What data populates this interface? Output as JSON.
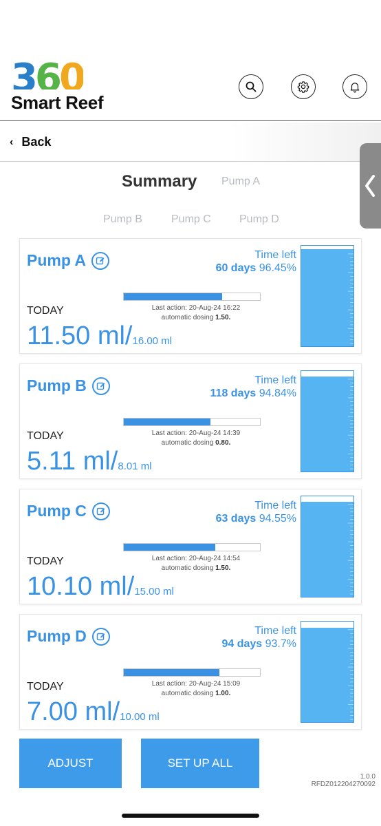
{
  "app": {
    "logo_number": [
      "3",
      "6",
      "0"
    ],
    "logo_text": "Smart Reef"
  },
  "header_icons": [
    "search-icon",
    "gear-icon",
    "bell-icon"
  ],
  "nav": {
    "back_label": "Back"
  },
  "tabs": [
    {
      "label": "Summary",
      "active": true
    },
    {
      "label": "Pump A",
      "active": false
    },
    {
      "label": "Pump B",
      "active": false
    },
    {
      "label": "Pump C",
      "active": false
    },
    {
      "label": "Pump D",
      "active": false
    }
  ],
  "pumps": [
    {
      "name": "Pump A",
      "time_left_label": "Time left",
      "days": "60 days",
      "percent": "96.45%",
      "tank_level": 0.9645,
      "progress": 0.72,
      "last_action": "Last action: 20-Aug-24 16:22",
      "dosing_label": "automatic dosing",
      "dosing_value": "1.50.",
      "today_label": "TODAY",
      "dosed": "11.50 ml/",
      "target": "16.00 ml"
    },
    {
      "name": "Pump B",
      "time_left_label": "Time left",
      "days": "118 days",
      "percent": "94.84%",
      "tank_level": 0.9484,
      "progress": 0.638,
      "last_action": "Last action: 20-Aug-24 14:39",
      "dosing_label": "automatic dosing",
      "dosing_value": "0.80.",
      "today_label": "TODAY",
      "dosed": "5.11 ml/",
      "target": "8.01 ml"
    },
    {
      "name": "Pump C",
      "time_left_label": "Time left",
      "days": "63 days",
      "percent": "94.55%",
      "tank_level": 0.9455,
      "progress": 0.673,
      "last_action": "Last action: 20-Aug-24 14:54",
      "dosing_label": "automatic dosing",
      "dosing_value": "1.50.",
      "today_label": "TODAY",
      "dosed": "10.10 ml/",
      "target": "15.00 ml"
    },
    {
      "name": "Pump D",
      "time_left_label": "Time left",
      "days": "94 days",
      "percent": "93.7%",
      "tank_level": 0.937,
      "progress": 0.7,
      "last_action": "Last action: 20-Aug-24 15:09",
      "dosing_label": "automatic dosing",
      "dosing_value": "1.00.",
      "today_label": "TODAY",
      "dosed": "7.00 ml/",
      "target": "10.00 ml"
    }
  ],
  "buttons": {
    "adjust": "ADJUST",
    "setup_all": "SET UP ALL"
  },
  "footer": {
    "version": "1.0.0",
    "serial": "RFDZ012204270092"
  },
  "colors": {
    "accent": "#3b92e3",
    "button": "#3d9be9",
    "tank_water": "#56b4f2"
  }
}
